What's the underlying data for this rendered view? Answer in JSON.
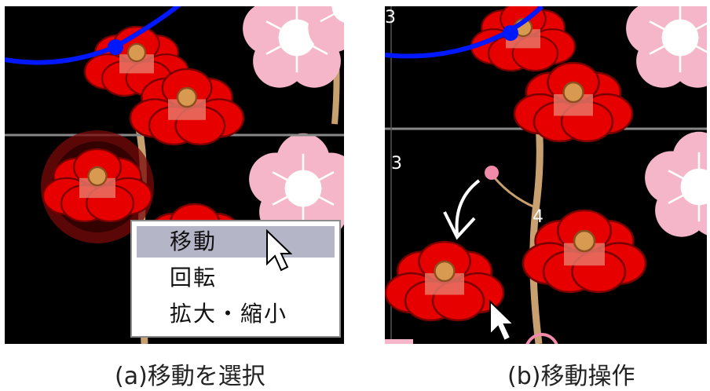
{
  "panel_a": {
    "context_menu": {
      "items": [
        {
          "label": "移動",
          "selected": true
        },
        {
          "label": "回転",
          "selected": false
        },
        {
          "label": "拡大・縮小",
          "selected": false
        }
      ]
    },
    "caption": "(a)移動を選択"
  },
  "panel_b": {
    "grid_labels": [
      "3",
      "3",
      "4"
    ],
    "caption": "(b)移動操作"
  },
  "colors": {
    "background": "#000000",
    "flower_red": "#e60000",
    "plum_pink": "#f4b6c8",
    "curve_blue": "#0018ff",
    "menu_highlight": "#b5b5c8",
    "handle_pink": "#f08aa8"
  },
  "icons": [
    "mouse-cursor-icon",
    "move-arrow-icon"
  ]
}
